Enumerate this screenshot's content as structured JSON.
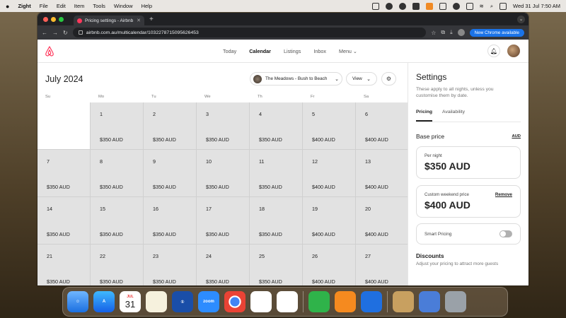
{
  "menubar": {
    "app_name": "Zight",
    "items": [
      "File",
      "Edit",
      "Item",
      "Tools",
      "Window",
      "Help"
    ],
    "datetime": "Wed 31 Jul  7:50 AM"
  },
  "browser": {
    "tab_title": "Pricing settings - Airbnb",
    "url": "airbnb.com.au/multicalendar/1032278715095626453",
    "update_button": "New Chrome available"
  },
  "nav": {
    "items": [
      {
        "label": "Today",
        "active": false
      },
      {
        "label": "Calendar",
        "active": true
      },
      {
        "label": "Listings",
        "active": false
      },
      {
        "label": "Inbox",
        "active": false
      },
      {
        "label": "Menu ⌄",
        "active": false
      }
    ]
  },
  "calendar": {
    "month": "July 2024",
    "listing": "The Meadows - Bush to Beach",
    "view_label": "View",
    "weekdays": [
      "Su",
      "Mo",
      "Tu",
      "We",
      "Th",
      "Fr",
      "Sa"
    ],
    "days": [
      {
        "day": "",
        "price": ""
      },
      {
        "day": "1",
        "price": "$350 AUD"
      },
      {
        "day": "2",
        "price": "$350 AUD"
      },
      {
        "day": "3",
        "price": "$350 AUD"
      },
      {
        "day": "4",
        "price": "$350 AUD"
      },
      {
        "day": "5",
        "price": "$400 AUD"
      },
      {
        "day": "6",
        "price": "$400 AUD"
      },
      {
        "day": "7",
        "price": "$350 AUD"
      },
      {
        "day": "8",
        "price": "$350 AUD"
      },
      {
        "day": "9",
        "price": "$350 AUD"
      },
      {
        "day": "10",
        "price": "$350 AUD"
      },
      {
        "day": "11",
        "price": "$350 AUD"
      },
      {
        "day": "12",
        "price": "$400 AUD"
      },
      {
        "day": "13",
        "price": "$400 AUD"
      },
      {
        "day": "14",
        "price": "$350 AUD"
      },
      {
        "day": "15",
        "price": "$350 AUD"
      },
      {
        "day": "16",
        "price": "$350 AUD"
      },
      {
        "day": "17",
        "price": "$350 AUD"
      },
      {
        "day": "18",
        "price": "$350 AUD"
      },
      {
        "day": "19",
        "price": "$400 AUD"
      },
      {
        "day": "20",
        "price": "$400 AUD"
      },
      {
        "day": "21",
        "price": "$350 AUD"
      },
      {
        "day": "22",
        "price": "$350 AUD"
      },
      {
        "day": "23",
        "price": "$350 AUD"
      },
      {
        "day": "24",
        "price": "$350 AUD"
      },
      {
        "day": "25",
        "price": "$350 AUD"
      },
      {
        "day": "26",
        "price": "$400 AUD"
      },
      {
        "day": "27",
        "price": "$400 AUD"
      }
    ]
  },
  "settings": {
    "title": "Settings",
    "subtitle": "These apply to all nights, unless you customise them by date.",
    "tabs": [
      "Pricing",
      "Availability"
    ],
    "base_price_label": "Base price",
    "currency": "AUD",
    "per_night_label": "Per night",
    "per_night_value": "$350 AUD",
    "weekend_label": "Custom weekend price",
    "weekend_remove": "Remove",
    "weekend_value": "$400 AUD",
    "smart_pricing_label": "Smart Pricing",
    "discounts_title": "Discounts",
    "discounts_sub": "Adjust your pricing to attract more guests"
  },
  "dock": {
    "calendar_month": "JUL",
    "calendar_day": "31",
    "zoom_label": "zoom"
  },
  "colors": {
    "brand": "#ff385c",
    "chrome_blue": "#1a73e8"
  }
}
